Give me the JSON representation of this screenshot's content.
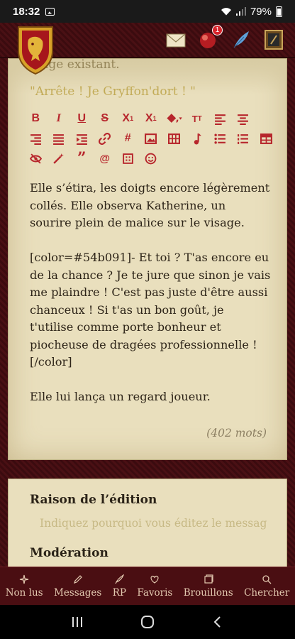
{
  "status_bar": {
    "time": "18:32",
    "battery": "79%"
  },
  "header": {
    "notification_count": "1"
  },
  "editor": {
    "previous_text": "...age existant.",
    "quote_line": "\"Arrête ! Je Gryffon'dort ! \"",
    "toolbar": {
      "row1": [
        "bold-icon",
        "italic-icon",
        "underline-icon",
        "strikethrough-icon",
        "subscript-icon",
        "superscript-icon",
        "paint-bucket-icon",
        "font-size-icon",
        "align-left-icon",
        "align-center-icon"
      ],
      "row2": [
        "align-right-icon",
        "justify-icon",
        "indent-icon",
        "link-icon",
        "hashtag-icon",
        "image-icon",
        "film-icon",
        "music-icon",
        "bulleted-list-icon",
        "numbered-list-icon",
        "table-icon"
      ],
      "row3": [
        "eye-slash-icon",
        "magic-wand-icon",
        "quote-icon",
        "mention-icon",
        "spoiler-icon",
        "smiley-icon"
      ]
    },
    "paragraphs": [
      "Elle s’étira, les doigts encore légèrement collés. Elle observa Katherine, un sourire plein de malice sur le visage.",
      "[color=#54b091]- Et toi ? T'as encore eu de la chance ? Je te jure que sinon je vais me plaindre ! C'est pas juste d'être aussi chanceux ! Si t'as un bon goût, je t'utilise comme porte bonheur et piocheuse de dragées professionnelle ![/color]",
      "Elle lui lança un regard joueur."
    ],
    "word_count": "(402 mots)"
  },
  "edit_reason": {
    "title": "Raison de l’édition",
    "placeholder": "Indiquez pourquoi vous éditez le message"
  },
  "moderation": {
    "title": "Modération"
  },
  "bottom_nav": {
    "items": [
      {
        "label": "Non lus",
        "icon": "sparkle-icon"
      },
      {
        "label": "Messages",
        "icon": "pencil-icon"
      },
      {
        "label": "RP",
        "icon": "quill-icon"
      },
      {
        "label": "Favoris",
        "icon": "heart-icon"
      },
      {
        "label": "Brouillons",
        "icon": "drafts-icon"
      },
      {
        "label": "Chercher",
        "icon": "search-icon"
      }
    ]
  },
  "colors": {
    "accent": "#b7262c",
    "parchment": "#e9dfbd",
    "maroon": "#4a0e12"
  }
}
